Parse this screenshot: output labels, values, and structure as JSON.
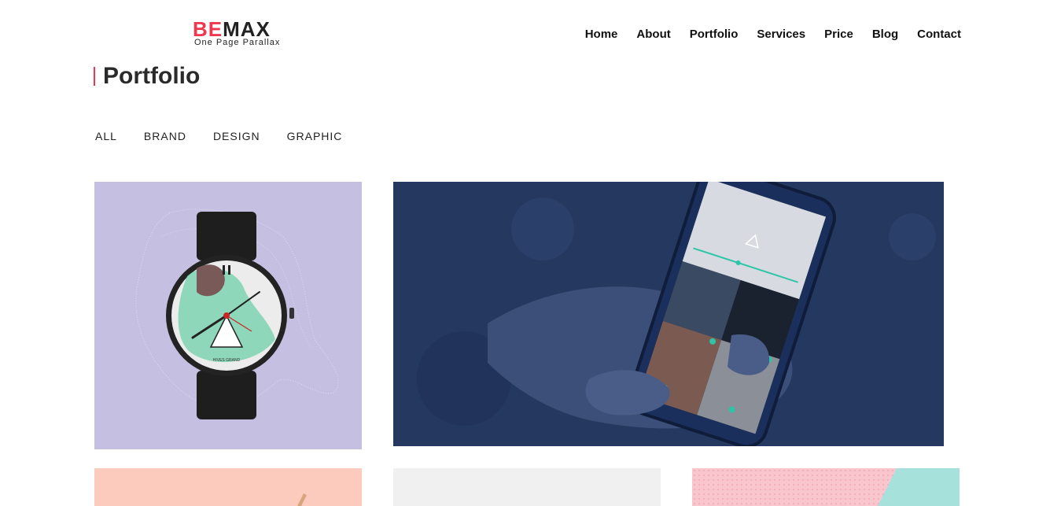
{
  "logo": {
    "part1": "BE",
    "part2": "MAX",
    "tagline": "One Page Parallax"
  },
  "nav": {
    "items": [
      "Home",
      "About",
      "Portfolio",
      "Services",
      "Price",
      "Blog",
      "Contact"
    ]
  },
  "section": {
    "title": "Portfolio"
  },
  "filters": [
    "ALL",
    "BRAND",
    "DESIGN",
    "GRAPHIC"
  ],
  "watch_face": {
    "brand": "HIVES GRAND"
  },
  "colors": {
    "accent": "#f0374f",
    "watch_bg": "#c5c0e2",
    "phone_bg": "#25385f",
    "peach": "#fdcbbd",
    "light_gray": "#f1f0f1",
    "pink": "#f8c6cc",
    "mint": "#a7e1dc"
  }
}
